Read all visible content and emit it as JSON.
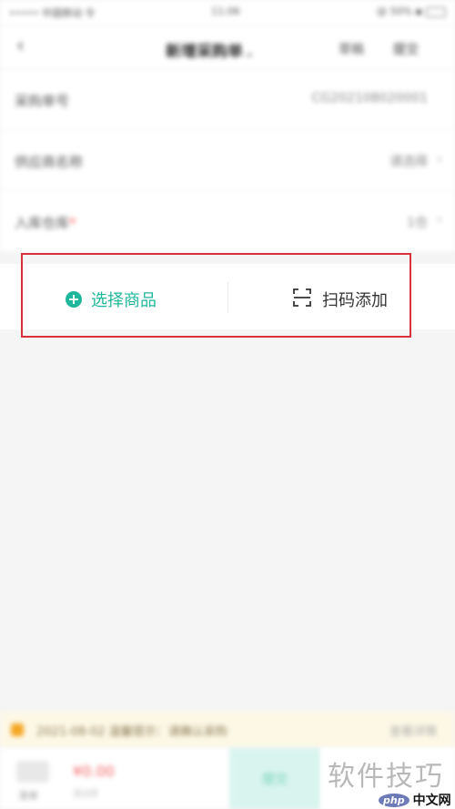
{
  "status_bar": {
    "carrier": "••••• 中国移动 令",
    "time": "11:06",
    "battery": "@ 50% ▪"
  },
  "nav": {
    "back": "‹",
    "title": "新增采购单",
    "right_action_1": "草稿",
    "right_action_2": "提交"
  },
  "form": {
    "rows": [
      {
        "label": "采购单号",
        "value": "CG202108020001",
        "arrow": ""
      },
      {
        "label": "供应商名称",
        "value": "请选择",
        "arrow": "›",
        "required": ""
      },
      {
        "label": "入库仓库",
        "value": "1仓",
        "arrow": "›",
        "required": "*"
      }
    ]
  },
  "actions": {
    "select_goods": "选择商品",
    "scan_add": "扫码添加"
  },
  "notice": {
    "text": "2021-08-02 温馨提示：请确认采购",
    "link": "查看详情"
  },
  "bottom": {
    "icon_label": "清单",
    "total": "¥0.00",
    "sub": "共0件",
    "submit": "提交"
  },
  "watermark": {
    "text": "软件技巧",
    "badge": "php",
    "site": "中文网"
  },
  "colors": {
    "accent": "#1fb79b",
    "highlight": "#d9303e",
    "notice_bg": "#fdf8e6"
  }
}
